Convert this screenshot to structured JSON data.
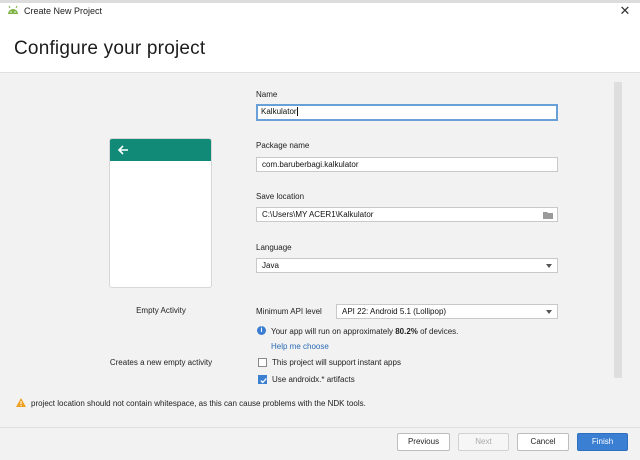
{
  "window": {
    "title": "Create New Project",
    "close_glyph": "✕",
    "app_icon": "android-studio-icon"
  },
  "header": {
    "title": "Configure your project"
  },
  "template": {
    "name": "Empty Activity",
    "description": "Creates a new empty activity",
    "toolbar_color": "#128a78",
    "icon": "back-arrow-icon"
  },
  "form": {
    "name": {
      "label": "Name",
      "value": "Kalkulator"
    },
    "package": {
      "label": "Package name",
      "value": "com.baruberbagi.kalkulator"
    },
    "save_location": {
      "label": "Save location",
      "value": "C:\\Users\\MY ACER1\\Kalkulator",
      "icon": "folder-icon"
    },
    "language": {
      "label": "Language",
      "value": "Java"
    },
    "min_api": {
      "label": "Minimum API level",
      "value": "API 22: Android 5.1 (Lollipop)"
    },
    "info": {
      "prefix": "Your app will run on approximately ",
      "percent": "80.2%",
      "suffix": " of devices.",
      "icon": "info-icon"
    },
    "help_link": "Help me choose",
    "instant_apps": {
      "label": "This project will support instant apps",
      "checked": false
    },
    "androidx": {
      "label": "Use androidx.* artifacts",
      "checked": true
    }
  },
  "warning": {
    "icon": "warning-icon",
    "text": "project location should not contain whitespace, as this can cause problems with the NDK tools."
  },
  "buttons": {
    "previous": "Previous",
    "next": "Next",
    "cancel": "Cancel",
    "finish": "Finish"
  },
  "colors": {
    "accent": "#3b7fd3",
    "warning": "#f0a020",
    "link": "#2a6ab3"
  }
}
